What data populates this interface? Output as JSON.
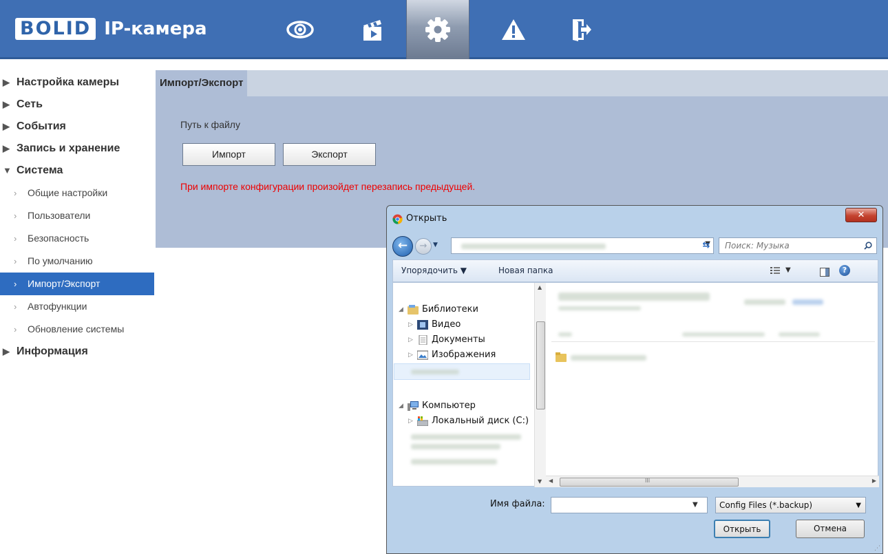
{
  "header": {
    "logo_text": "BOLID",
    "app_title": "IP-камера",
    "nav": [
      {
        "icon": "eye-icon",
        "label": "Просмотр"
      },
      {
        "icon": "clapperboard-icon",
        "label": "Воспроизведение"
      },
      {
        "icon": "gear-icon",
        "label": "Настройки",
        "active": true
      },
      {
        "icon": "alarm-icon",
        "label": "Тревога"
      },
      {
        "icon": "logout-icon",
        "label": "Выход"
      }
    ]
  },
  "sidebar": {
    "sections": [
      {
        "label": "Настройка камеры",
        "expanded": false
      },
      {
        "label": "Сеть",
        "expanded": false
      },
      {
        "label": "События",
        "expanded": false
      },
      {
        "label": "Запись и хранение",
        "expanded": false
      },
      {
        "label": "Система",
        "expanded": true
      },
      {
        "label": "Информация",
        "expanded": false
      }
    ],
    "system_items": [
      {
        "label": "Общие настройки"
      },
      {
        "label": "Пользователи"
      },
      {
        "label": "Безопасность"
      },
      {
        "label": "По умолчанию"
      },
      {
        "label": "Импорт/Экспорт",
        "selected": true
      },
      {
        "label": "Автофункции"
      },
      {
        "label": "Обновление системы"
      }
    ]
  },
  "main": {
    "tab": "Импорт/Экспорт",
    "path_label": "Путь к файлу",
    "import_button": "Импорт",
    "export_button": "Экспорт",
    "warning": "При импорте конфигурации произойдет перезапись предыдущей."
  },
  "dialog": {
    "title": "Открыть",
    "search_placeholder": "Поиск: Музыка",
    "organize": "Упорядочить ▼",
    "new_folder": "Новая папка",
    "tree": {
      "libraries": "Библиотеки",
      "video": "Видео",
      "documents": "Документы",
      "images": "Изображения",
      "computer": "Компьютер",
      "local_disk": "Локальный диск (C:)"
    },
    "filename_label": "Имя файла:",
    "filename_value": "",
    "filter": "Config Files (*.backup)",
    "open_button": "Открыть",
    "cancel_button": "Отмена",
    "colors": {
      "accent": "#2e6cc0",
      "header": "#3f6fb4",
      "warning": "#ff0000"
    }
  }
}
